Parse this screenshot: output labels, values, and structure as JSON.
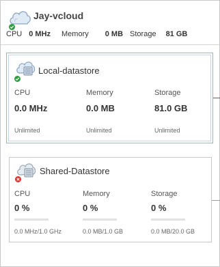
{
  "vcloud": {
    "name": "Jay-vcloud",
    "status": "ok",
    "cpu_label": "CPU",
    "cpu_value": "0 MHz",
    "memory_label": "Memory",
    "memory_value": "0 MB",
    "storage_label": "Storage",
    "storage_value": "81 GB"
  },
  "datastores": [
    {
      "name": "Local-datastore",
      "status": "ok",
      "cpu_label": "CPU",
      "cpu_value": "0.0 MHz",
      "cpu_sub": "Unlimited",
      "memory_label": "Memory",
      "memory_value": "0.0 MB",
      "memory_sub": "Unlimited",
      "storage_label": "Storage",
      "storage_value": "81.0 GB",
      "storage_sub": "Unlimited"
    },
    {
      "name": "Shared-Datastore",
      "status": "error",
      "cpu_label": "CPU",
      "cpu_value": "0 %",
      "cpu_sub": "0.0 MHz/1.0 GHz",
      "cpu_usage_fraction": 0,
      "memory_label": "Memory",
      "memory_value": "0 %",
      "memory_sub": "0.0 MB/1.0 GB",
      "memory_usage_fraction": 0,
      "storage_label": "Storage",
      "storage_value": "0 %",
      "storage_sub": "0.0 MB/20.0 GB",
      "storage_usage_fraction": 0
    }
  ],
  "colors": {
    "ok": "#2e9e3e",
    "error": "#d9342b",
    "connector_active": "#c0392b",
    "connector_idle": "#9a9a9a",
    "bar_track": "#e2e2e2"
  }
}
